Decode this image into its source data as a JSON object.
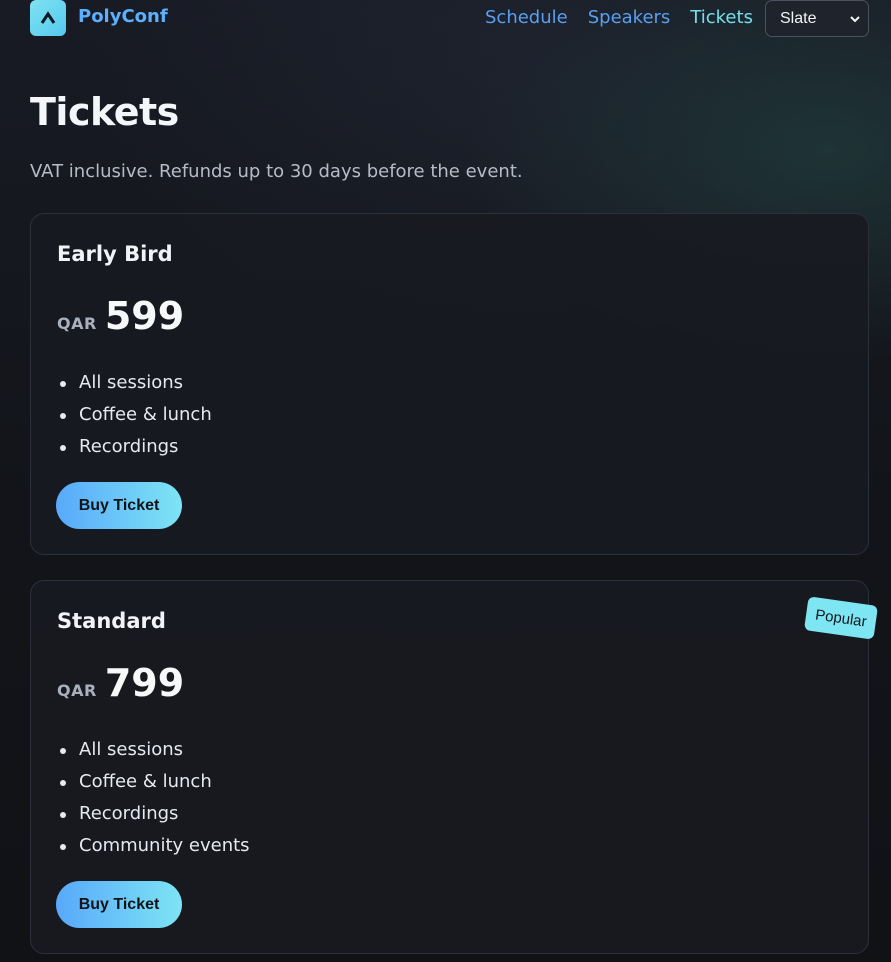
{
  "header": {
    "brand": "PolyConf",
    "logo_icon": "chevron-up-icon",
    "nav": [
      {
        "label": "Schedule",
        "active": false
      },
      {
        "label": "Speakers",
        "active": false
      },
      {
        "label": "Tickets",
        "active": true
      }
    ],
    "theme_select": {
      "value": "Slate"
    }
  },
  "page": {
    "title": "Tickets",
    "subtitle": "VAT inclusive. Refunds up to 30 days before the event."
  },
  "tickets": [
    {
      "name": "Early Bird",
      "currency": "QAR",
      "price": "599",
      "features": [
        "All sessions",
        "Coffee & lunch",
        "Recordings"
      ],
      "button": "Buy Ticket"
    },
    {
      "name": "Standard",
      "currency": "QAR",
      "price": "799",
      "badge": "Popular",
      "features": [
        "All sessions",
        "Coffee & lunch",
        "Recordings",
        "Community events"
      ],
      "button": "Buy Ticket"
    }
  ],
  "colors": {
    "accent_blue": "#5a9ff0",
    "accent_cyan": "#72e0ea",
    "background": "#121419",
    "card": "#181a21"
  }
}
